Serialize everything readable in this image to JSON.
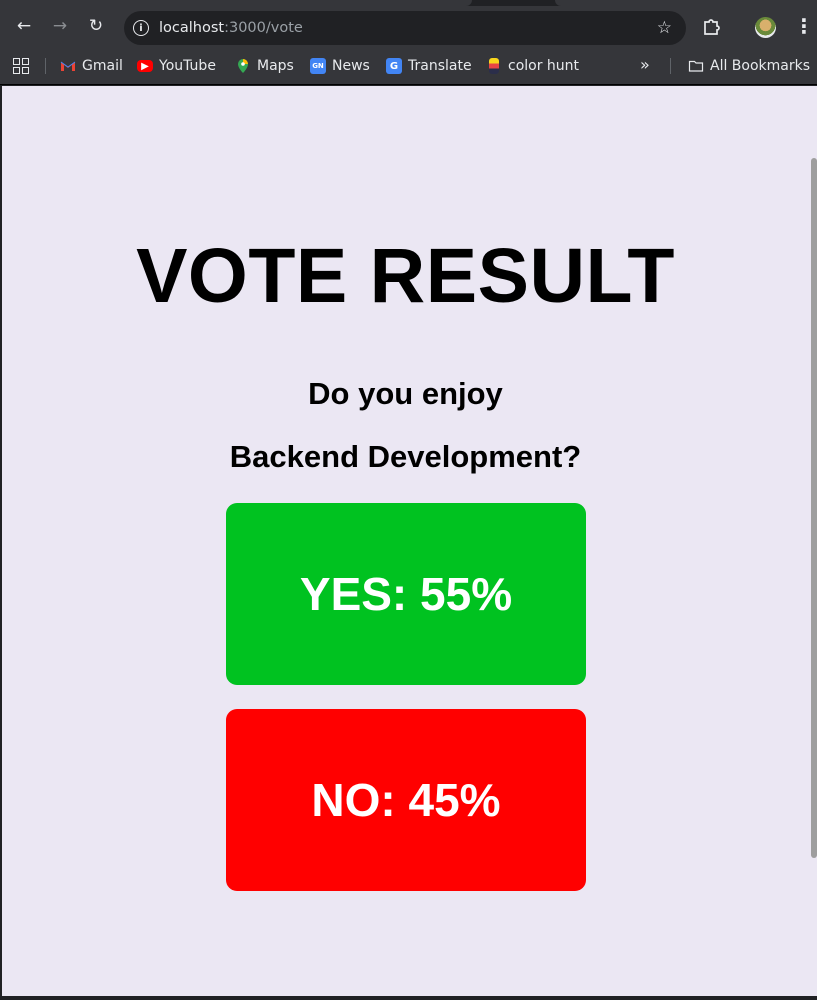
{
  "browser": {
    "url_host": "localhost",
    "url_path": ":3000/vote"
  },
  "bookmarks": [
    {
      "label": "Gmail",
      "icon": "gmail-icon",
      "color": "#ea4335"
    },
    {
      "label": "YouTube",
      "icon": "youtube-icon",
      "color": "#ff0000"
    },
    {
      "label": "Maps",
      "icon": "maps-icon",
      "color": "#34a853"
    },
    {
      "label": "News",
      "icon": "news-icon",
      "color": "#4285f4"
    },
    {
      "label": "Translate",
      "icon": "translate-icon",
      "color": "#4285f4"
    },
    {
      "label": "color hunt",
      "icon": "colorhunt-icon",
      "color": "#f9d71c"
    }
  ],
  "all_bookmarks_label": "All Bookmarks",
  "page": {
    "title": "VOTE RESULT",
    "question_line1": "Do you enjoy",
    "question_line2": "Backend Development?",
    "background": "#ebe7f3",
    "results": {
      "yes": {
        "text": "YES: 55%",
        "percent": 55,
        "color": "#00c220"
      },
      "no": {
        "text": "NO: 45%",
        "percent": 45,
        "color": "#ff0000"
      }
    }
  }
}
